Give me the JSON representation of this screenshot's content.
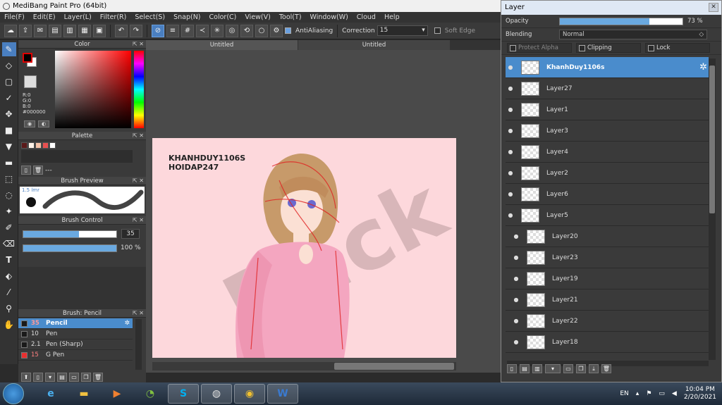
{
  "window": {
    "title": "MediBang Paint Pro (64bit)"
  },
  "menu": [
    "File(F)",
    "Edit(E)",
    "Layer(L)",
    "Filter(R)",
    "Select(S)",
    "Snap(N)",
    "Color(C)",
    "View(V)",
    "Tool(T)",
    "Window(W)",
    "Cloud",
    "Help"
  ],
  "toolbar": {
    "antialiasing_label": "AntiAliasing",
    "correction_label": "Correction",
    "correction_value": "15",
    "soft_edge_label": "Soft Edge"
  },
  "color_panel": {
    "title": "Color",
    "rgb_r": "R:0",
    "rgb_g": "G:0",
    "rgb_b": "B:0",
    "hex": "#000000"
  },
  "palette_panel": {
    "title": "Palette",
    "swatch_colors": [
      "#5a1a1a",
      "#fff2e8",
      "#f4c2a8",
      "#e85050",
      "#ffffff"
    ],
    "placeholder": "---"
  },
  "brush_preview": {
    "title": "Brush Preview",
    "size_label": "1.5 lmr"
  },
  "brush_control": {
    "title": "Brush Control",
    "size_value": "35",
    "size_fraction": 0.6,
    "opacity_value": "100 %",
    "opacity_fraction": 1.0
  },
  "brush_list": {
    "title": "Brush: Pencil",
    "items": [
      {
        "num": "35",
        "name": "Pencil",
        "color": "#1a1a1a",
        "selected": true
      },
      {
        "num": "10",
        "name": "Pen",
        "color": "#1a1a1a",
        "selected": false
      },
      {
        "num": "2.1",
        "name": "Pen (Sharp)",
        "color": "#1a1a1a",
        "selected": false
      },
      {
        "num": "15",
        "name": "G Pen",
        "color": "#e83030",
        "selected": false
      }
    ]
  },
  "canvas": {
    "tabs": [
      "Untitled",
      "Untitled"
    ],
    "watermark_line1": "KHANHDUY1106S",
    "watermark_line2": "HOIDAP247",
    "big_watermark": "Dack"
  },
  "layer_window": {
    "title": "Layer",
    "opacity_label": "Opacity",
    "opacity_value": "73 %",
    "opacity_fraction": 0.73,
    "blending_label": "Blending",
    "blending_value": "Normal",
    "protect_alpha_label": "Protect Alpha",
    "clipping_label": "Clipping",
    "lock_label": "Lock",
    "layers": [
      {
        "name": "KhanhDuy1106s",
        "selected": true,
        "indent": false
      },
      {
        "name": "Layer27",
        "selected": false,
        "indent": false
      },
      {
        "name": "Layer1",
        "selected": false,
        "indent": false
      },
      {
        "name": "Layer3",
        "selected": false,
        "indent": false
      },
      {
        "name": "Layer4",
        "selected": false,
        "indent": false
      },
      {
        "name": "Layer2",
        "selected": false,
        "indent": false
      },
      {
        "name": "Layer6",
        "selected": false,
        "indent": false
      },
      {
        "name": "Layer5",
        "selected": false,
        "indent": false
      },
      {
        "name": "Layer20",
        "selected": false,
        "indent": true
      },
      {
        "name": "Layer23",
        "selected": false,
        "indent": true
      },
      {
        "name": "Layer19",
        "selected": false,
        "indent": true
      },
      {
        "name": "Layer21",
        "selected": false,
        "indent": true
      },
      {
        "name": "Layer22",
        "selected": false,
        "indent": true
      },
      {
        "name": "Layer18",
        "selected": false,
        "indent": true
      }
    ]
  },
  "taskbar": {
    "language": "EN",
    "time": "10:04 PM",
    "date": "2/20/2021",
    "apps": [
      "ie",
      "explorer",
      "media",
      "cc",
      "skype",
      "paint",
      "chrome",
      "word"
    ]
  }
}
